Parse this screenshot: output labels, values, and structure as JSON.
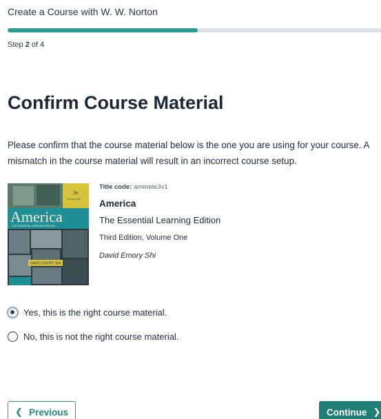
{
  "header": {
    "title": "Create a Course with W. W. Norton"
  },
  "progress": {
    "fraction": 0.51
  },
  "step": {
    "prefix": "Step",
    "current": "2",
    "suffix": "of 4"
  },
  "main": {
    "title": "Confirm Course Material",
    "intro": "Please confirm that the course material below is the one you are using for your course. A mismatch in the course material will result in an incorrect course setup."
  },
  "book": {
    "title_code_label": "Title code:",
    "title_code": "amerele3v1",
    "title": "America",
    "subtitle": "The Essential Learning Edition",
    "edition": "Third Edition, Volume One",
    "author": "David Emory Shi",
    "cover": {
      "title": "America",
      "subtitle": "THE ESSENTIAL LEARNING EDITION",
      "edition_badge": "3e",
      "volume_badge": "VOLUME ONE",
      "author": "DAVID EMORY SHI",
      "colors": {
        "teal": "#1f8e97",
        "yellow": "#d8c33c",
        "dark": "#2b3a3f"
      }
    }
  },
  "options": [
    {
      "label": "Yes, this is the right course material.",
      "checked": true
    },
    {
      "label": "No, this is not the right course material.",
      "checked": false
    }
  ],
  "footer": {
    "previous_label": "Previous",
    "continue_label": "Continue"
  },
  "colors": {
    "accent": "#2a9d93",
    "primary_button": "#1f7f77",
    "track": "#dfe3e8"
  },
  "icons": {
    "previous": "chevron-left-icon",
    "continue": "chevron-right-icon"
  }
}
